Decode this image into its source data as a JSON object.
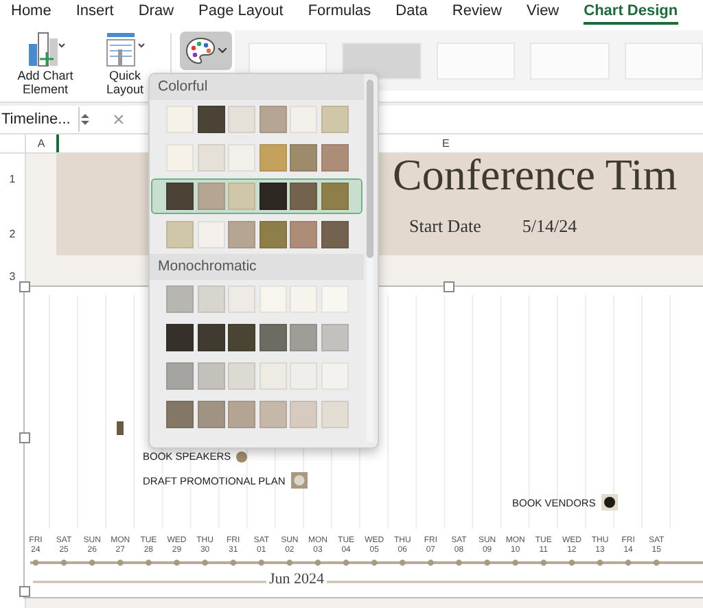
{
  "ribbon_tabs": [
    {
      "label": "Home",
      "selected": false
    },
    {
      "label": "Insert",
      "selected": false
    },
    {
      "label": "Draw",
      "selected": false
    },
    {
      "label": "Page Layout",
      "selected": false
    },
    {
      "label": "Formulas",
      "selected": false
    },
    {
      "label": "Data",
      "selected": false
    },
    {
      "label": "Review",
      "selected": false
    },
    {
      "label": "View",
      "selected": false
    },
    {
      "label": "Chart Design",
      "selected": true
    }
  ],
  "ribbon_buttons": [
    {
      "label": "Add Chart Element",
      "kind": "element"
    },
    {
      "label": "Quick Layout",
      "kind": "layout"
    }
  ],
  "chart_styles": [
    {
      "selected": false
    },
    {
      "selected": true
    },
    {
      "selected": false
    },
    {
      "selected": false
    },
    {
      "selected": false
    }
  ],
  "name_box": "Timeline...",
  "formula_cancel": "×",
  "columns": [
    "A",
    "E"
  ],
  "rows": [
    "1",
    "2",
    "3"
  ],
  "sheet": {
    "title": "Conference Tim",
    "start_label": "Start Date",
    "start_value": "5/14/24"
  },
  "color_menu": {
    "sections": [
      {
        "title": "Colorful",
        "palettes": [
          {
            "selected": false,
            "swatches": [
              {
                "color": "#f6f2ea"
              },
              {
                "color": "#4a4336"
              },
              {
                "color": "#e6e1d8"
              },
              {
                "color": "#b6a592"
              },
              {
                "color": "#f3f0ec"
              },
              {
                "color": "#d0c6a8"
              }
            ]
          },
          {
            "selected": false,
            "swatches": [
              {
                "color": "#f6f2ea"
              },
              {
                "color": "#e6e1d8"
              },
              {
                "color": "#f3f0ec"
              },
              {
                "color": "#c4a25d"
              },
              {
                "color": "#9e8b6c"
              },
              {
                "color": "#ad8c78"
              }
            ]
          },
          {
            "selected": true,
            "swatches": [
              {
                "color": "#4a4336"
              },
              {
                "color": "#b6a592"
              },
              {
                "color": "#d0c6a8"
              },
              {
                "color": "#2c2721"
              },
              {
                "color": "#73624d"
              },
              {
                "color": "#8e7f4a"
              }
            ]
          },
          {
            "selected": false,
            "swatches": [
              {
                "color": "#d0c6a8"
              },
              {
                "color": "#f3f0ec"
              },
              {
                "color": "#b6a592"
              },
              {
                "color": "#8e7f4a"
              },
              {
                "color": "#ad8c78"
              },
              {
                "color": "#73624d"
              }
            ]
          }
        ]
      },
      {
        "title": "Monochromatic",
        "palettes": [
          {
            "selected": false,
            "swatches": [
              {
                "color": "#b8b6b0"
              },
              {
                "color": "#d8d4ce"
              },
              {
                "color": "#eeebe6"
              },
              {
                "color": "#f8f5ee"
              },
              {
                "color": "#f7f4ee"
              },
              {
                "color": "#f9f7f2"
              }
            ]
          },
          {
            "selected": false,
            "swatches": [
              {
                "color": "#35302a"
              },
              {
                "color": "#3f3b30"
              },
              {
                "color": "#4a4434"
              },
              {
                "color": "#6e6b62"
              },
              {
                "color": "#9e9d98"
              },
              {
                "color": "#c2c1be"
              }
            ]
          },
          {
            "selected": false,
            "swatches": [
              {
                "color": "#a6a4a0"
              },
              {
                "color": "#c4c1bb"
              },
              {
                "color": "#dddad2"
              },
              {
                "color": "#eeebe2"
              },
              {
                "color": "#efeeea"
              },
              {
                "color": "#f3f2ef"
              }
            ]
          },
          {
            "selected": false,
            "swatches": [
              {
                "color": "#857766"
              },
              {
                "color": "#a09382"
              },
              {
                "color": "#b3a592"
              },
              {
                "color": "#c6b8a8"
              },
              {
                "color": "#d6cbbe"
              },
              {
                "color": "#e3ddd4"
              }
            ]
          }
        ]
      }
    ]
  },
  "chart": {
    "tasks": [
      {
        "label": "BOOK SPEAKERS",
        "kind": "circle",
        "color": "#a08c6a"
      },
      {
        "label": "DRAFT PROMOTIONAL PLAN",
        "kind": "square",
        "color": "#a89a80"
      },
      {
        "label": "BOOK VENDORS",
        "kind": "dot",
        "color": "#1e1c1a"
      }
    ],
    "dates": [
      {
        "day": "FRI",
        "date": "24"
      },
      {
        "day": "SAT",
        "date": "25"
      },
      {
        "day": "SUN",
        "date": "26"
      },
      {
        "day": "MON",
        "date": "27"
      },
      {
        "day": "TUE",
        "date": "28"
      },
      {
        "day": "WED",
        "date": "29"
      },
      {
        "day": "THU",
        "date": "30"
      },
      {
        "day": "FRI",
        "date": "31"
      },
      {
        "day": "SAT",
        "date": "01"
      },
      {
        "day": "SUN",
        "date": "02"
      },
      {
        "day": "MON",
        "date": "03"
      },
      {
        "day": "TUE",
        "date": "04"
      },
      {
        "day": "WED",
        "date": "05"
      },
      {
        "day": "THU",
        "date": "06"
      },
      {
        "day": "FRI",
        "date": "07"
      },
      {
        "day": "SAT",
        "date": "08"
      },
      {
        "day": "SUN",
        "date": "09"
      },
      {
        "day": "MON",
        "date": "10"
      },
      {
        "day": "TUE",
        "date": "11"
      },
      {
        "day": "WED",
        "date": "12"
      },
      {
        "day": "THU",
        "date": "13"
      },
      {
        "day": "FRI",
        "date": "14"
      },
      {
        "day": "SAT",
        "date": "15"
      }
    ],
    "month": "Jun 2024"
  }
}
